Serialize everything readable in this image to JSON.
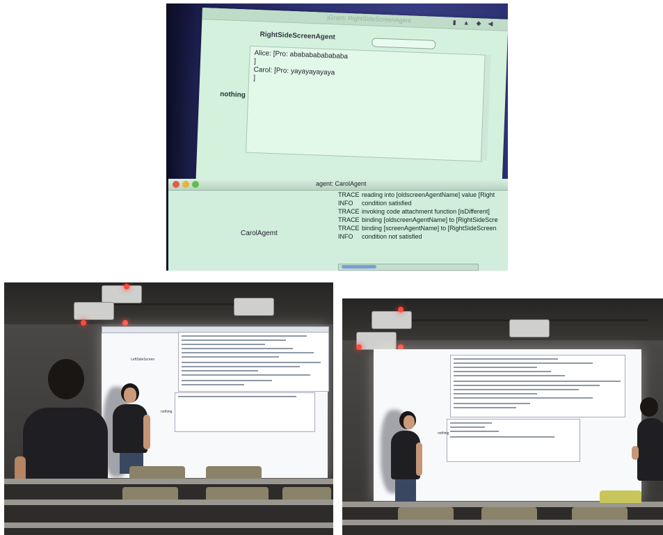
{
  "top_photo": {
    "right_window": {
      "title": "jGram: RightSideScreenAgent",
      "agent_title": "RightSideScreenAgent",
      "chat_lines": [
        "Alice: [Pro: abababababababa",
        "]",
        "Carol: [Pro: yayayayayaya",
        "]"
      ],
      "side_label": "nothing"
    },
    "bottom_window": {
      "title": "agent: CarolAgent",
      "agent_label": "CarolAgemt",
      "log": [
        {
          "level": "TRACE",
          "message": "reading into [oldscreenAgentName] value [Right"
        },
        {
          "level": "INFO",
          "message": "condition satisfied"
        },
        {
          "level": "TRACE",
          "message": "invoking code attachment function [isDifferent]"
        },
        {
          "level": "TRACE",
          "message": "binding [oldscreenAgentName] to [RightSideScre"
        },
        {
          "level": "TRACE",
          "message": "binding [screenAgentName] to [RightSideScreen"
        },
        {
          "level": "INFO",
          "message": "condition not satisfied"
        }
      ]
    }
  },
  "bottom_left_photo": {
    "screen_label": "LeftSideScreen",
    "side_label": "nothing"
  },
  "bottom_right_photo": {
    "side_label": "nothing"
  },
  "colors": {
    "screen_green": "#d3f1dc",
    "desktop_blue": "#25296a",
    "room_dark": "#3b3936",
    "projector_light": "#ff4c3c"
  }
}
